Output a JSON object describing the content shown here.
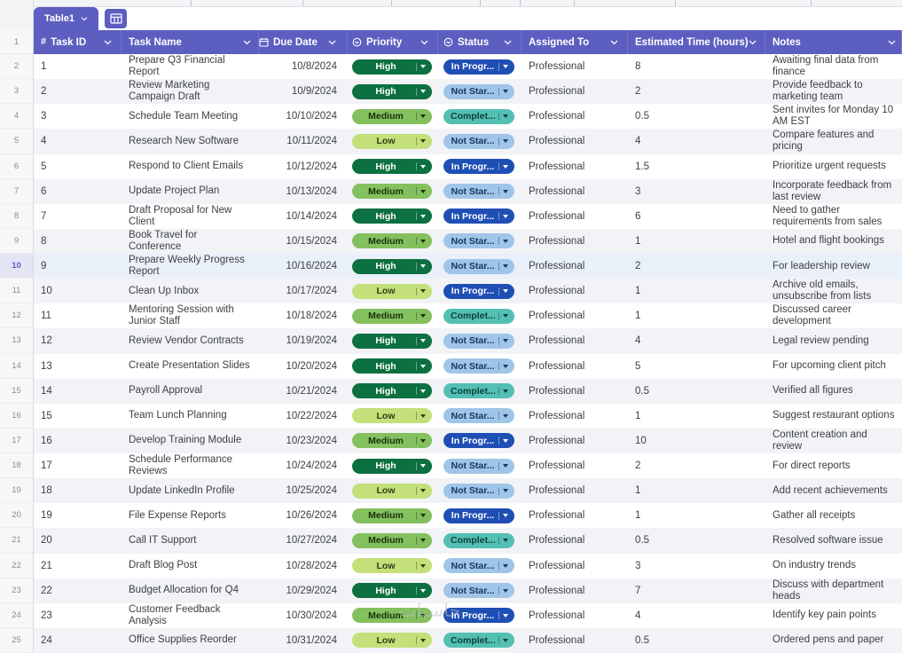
{
  "window": {
    "tab_label": "Table1",
    "watermark": "حاسبات"
  },
  "header": {
    "columns": [
      {
        "id": "task_id",
        "label": "Task ID",
        "icon": "hash"
      },
      {
        "id": "task_name",
        "label": "Task Name",
        "icon": null
      },
      {
        "id": "due_date",
        "label": "Due Date",
        "icon": "calendar"
      },
      {
        "id": "priority",
        "label": "Priority",
        "icon": "select-circle"
      },
      {
        "id": "status",
        "label": "Status",
        "icon": "select-circle"
      },
      {
        "id": "assigned_to",
        "label": "Assigned To",
        "icon": null
      },
      {
        "id": "estimated_time",
        "label": "Estimated Time (hours)",
        "icon": null
      },
      {
        "id": "notes",
        "label": "Notes",
        "icon": null
      }
    ]
  },
  "gutter": {
    "header_row": "1"
  },
  "rows": [
    {
      "gutter": "2",
      "task_id": "1",
      "task_name": "Prepare Q3 Financial Report",
      "due_date": "10/8/2024",
      "priority": "High",
      "status": "In Progr...",
      "assigned_to": "Professional",
      "estimated_time": "8",
      "notes": "Awaiting final data from finance",
      "selected": false
    },
    {
      "gutter": "3",
      "task_id": "2",
      "task_name": "Review Marketing Campaign Draft",
      "due_date": "10/9/2024",
      "priority": "High",
      "status": "Not Star...",
      "assigned_to": "Professional",
      "estimated_time": "2",
      "notes": "Provide feedback to marketing team",
      "selected": false
    },
    {
      "gutter": "4",
      "task_id": "3",
      "task_name": "Schedule Team Meeting",
      "due_date": "10/10/2024",
      "priority": "Medium",
      "status": "Complet...",
      "assigned_to": "Professional",
      "estimated_time": "0.5",
      "notes": "Sent invites for Monday 10 AM EST",
      "selected": false
    },
    {
      "gutter": "5",
      "task_id": "4",
      "task_name": "Research New Software",
      "due_date": "10/11/2024",
      "priority": "Low",
      "status": "Not Star...",
      "assigned_to": "Professional",
      "estimated_time": "4",
      "notes": "Compare features and pricing",
      "selected": false
    },
    {
      "gutter": "6",
      "task_id": "5",
      "task_name": "Respond to Client Emails",
      "due_date": "10/12/2024",
      "priority": "High",
      "status": "In Progr...",
      "assigned_to": "Professional",
      "estimated_time": "1.5",
      "notes": "Prioritize urgent requests",
      "selected": false
    },
    {
      "gutter": "7",
      "task_id": "6",
      "task_name": "Update Project Plan",
      "due_date": "10/13/2024",
      "priority": "Medium",
      "status": "Not Star...",
      "assigned_to": "Professional",
      "estimated_time": "3",
      "notes": "Incorporate feedback from last review",
      "selected": false
    },
    {
      "gutter": "8",
      "task_id": "7",
      "task_name": "Draft Proposal for New Client",
      "due_date": "10/14/2024",
      "priority": "High",
      "status": "In Progr...",
      "assigned_to": "Professional",
      "estimated_time": "6",
      "notes": "Need to gather requirements from sales",
      "selected": false
    },
    {
      "gutter": "9",
      "task_id": "8",
      "task_name": "Book Travel for Conference",
      "due_date": "10/15/2024",
      "priority": "Medium",
      "status": "Not Star...",
      "assigned_to": "Professional",
      "estimated_time": "1",
      "notes": "Hotel and flight bookings",
      "selected": false
    },
    {
      "gutter": "10",
      "task_id": "9",
      "task_name": "Prepare Weekly Progress Report",
      "due_date": "10/16/2024",
      "priority": "High",
      "status": "Not Star...",
      "assigned_to": "Professional",
      "estimated_time": "2",
      "notes": "For leadership review",
      "selected": true
    },
    {
      "gutter": "11",
      "task_id": "10",
      "task_name": "Clean Up Inbox",
      "due_date": "10/17/2024",
      "priority": "Low",
      "status": "In Progr...",
      "assigned_to": "Professional",
      "estimated_time": "1",
      "notes": "Archive old emails, unsubscribe from lists",
      "selected": false
    },
    {
      "gutter": "12",
      "task_id": "11",
      "task_name": "Mentoring Session with Junior Staff",
      "due_date": "10/18/2024",
      "priority": "Medium",
      "status": "Complet...",
      "assigned_to": "Professional",
      "estimated_time": "1",
      "notes": "Discussed career development",
      "selected": false
    },
    {
      "gutter": "13",
      "task_id": "12",
      "task_name": "Review Vendor Contracts",
      "due_date": "10/19/2024",
      "priority": "High",
      "status": "Not Star...",
      "assigned_to": "Professional",
      "estimated_time": "4",
      "notes": "Legal review pending",
      "selected": false
    },
    {
      "gutter": "14",
      "task_id": "13",
      "task_name": "Create Presentation Slides",
      "due_date": "10/20/2024",
      "priority": "High",
      "status": "Not Star...",
      "assigned_to": "Professional",
      "estimated_time": "5",
      "notes": "For upcoming client pitch",
      "selected": false
    },
    {
      "gutter": "15",
      "task_id": "14",
      "task_name": "Payroll Approval",
      "due_date": "10/21/2024",
      "priority": "High",
      "status": "Complet...",
      "assigned_to": "Professional",
      "estimated_time": "0.5",
      "notes": "Verified all figures",
      "selected": false
    },
    {
      "gutter": "16",
      "task_id": "15",
      "task_name": "Team Lunch Planning",
      "due_date": "10/22/2024",
      "priority": "Low",
      "status": "Not Star...",
      "assigned_to": "Professional",
      "estimated_time": "1",
      "notes": "Suggest restaurant options",
      "selected": false
    },
    {
      "gutter": "17",
      "task_id": "16",
      "task_name": "Develop Training Module",
      "due_date": "10/23/2024",
      "priority": "Medium",
      "status": "In Progr...",
      "assigned_to": "Professional",
      "estimated_time": "10",
      "notes": "Content creation and review",
      "selected": false
    },
    {
      "gutter": "18",
      "task_id": "17",
      "task_name": "Schedule Performance Reviews",
      "due_date": "10/24/2024",
      "priority": "High",
      "status": "Not Star...",
      "assigned_to": "Professional",
      "estimated_time": "2",
      "notes": "For direct reports",
      "selected": false
    },
    {
      "gutter": "19",
      "task_id": "18",
      "task_name": "Update LinkedIn Profile",
      "due_date": "10/25/2024",
      "priority": "Low",
      "status": "Not Star...",
      "assigned_to": "Professional",
      "estimated_time": "1",
      "notes": "Add recent achievements",
      "selected": false
    },
    {
      "gutter": "20",
      "task_id": "19",
      "task_name": "File Expense Reports",
      "due_date": "10/26/2024",
      "priority": "Medium",
      "status": "In Progr...",
      "assigned_to": "Professional",
      "estimated_time": "1",
      "notes": "Gather all receipts",
      "selected": false
    },
    {
      "gutter": "21",
      "task_id": "20",
      "task_name": "Call IT Support",
      "due_date": "10/27/2024",
      "priority": "Medium",
      "status": "Complet...",
      "assigned_to": "Professional",
      "estimated_time": "0.5",
      "notes": "Resolved software issue",
      "selected": false
    },
    {
      "gutter": "22",
      "task_id": "21",
      "task_name": "Draft Blog Post",
      "due_date": "10/28/2024",
      "priority": "Low",
      "status": "Not Star...",
      "assigned_to": "Professional",
      "estimated_time": "3",
      "notes": "On industry trends",
      "selected": false
    },
    {
      "gutter": "23",
      "task_id": "22",
      "task_name": "Budget Allocation for Q4",
      "due_date": "10/29/2024",
      "priority": "High",
      "status": "Not Star...",
      "assigned_to": "Professional",
      "estimated_time": "7",
      "notes": "Discuss with department heads",
      "selected": false
    },
    {
      "gutter": "24",
      "task_id": "23",
      "task_name": "Customer Feedback Analysis",
      "due_date": "10/30/2024",
      "priority": "Medium",
      "status": "In Progr...",
      "assigned_to": "Professional",
      "estimated_time": "4",
      "notes": "Identify key pain points",
      "selected": false
    },
    {
      "gutter": "25",
      "task_id": "24",
      "task_name": "Office Supplies Reorder",
      "due_date": "10/31/2024",
      "priority": "Low",
      "status": "Complet...",
      "assigned_to": "Professional",
      "estimated_time": "0.5",
      "notes": "Ordered pens and paper",
      "selected": false
    }
  ],
  "colors": {
    "accent": "#5C5EC0",
    "priority": {
      "High": {
        "bg": "#0C7040",
        "text": "#FFFFFF"
      },
      "Medium": {
        "bg": "#84C05E",
        "text": "#17310D"
      },
      "Low": {
        "bg": "#C3E07A",
        "text": "#333D12"
      }
    },
    "status": {
      "In Progr...": {
        "bg": "#1F4FB5",
        "text": "#FFFFFF"
      },
      "Not Star...": {
        "bg": "#9FC5E8",
        "text": "#1A3760"
      },
      "Complet...": {
        "bg": "#54BFB3",
        "text": "#0C3F3A"
      }
    }
  }
}
